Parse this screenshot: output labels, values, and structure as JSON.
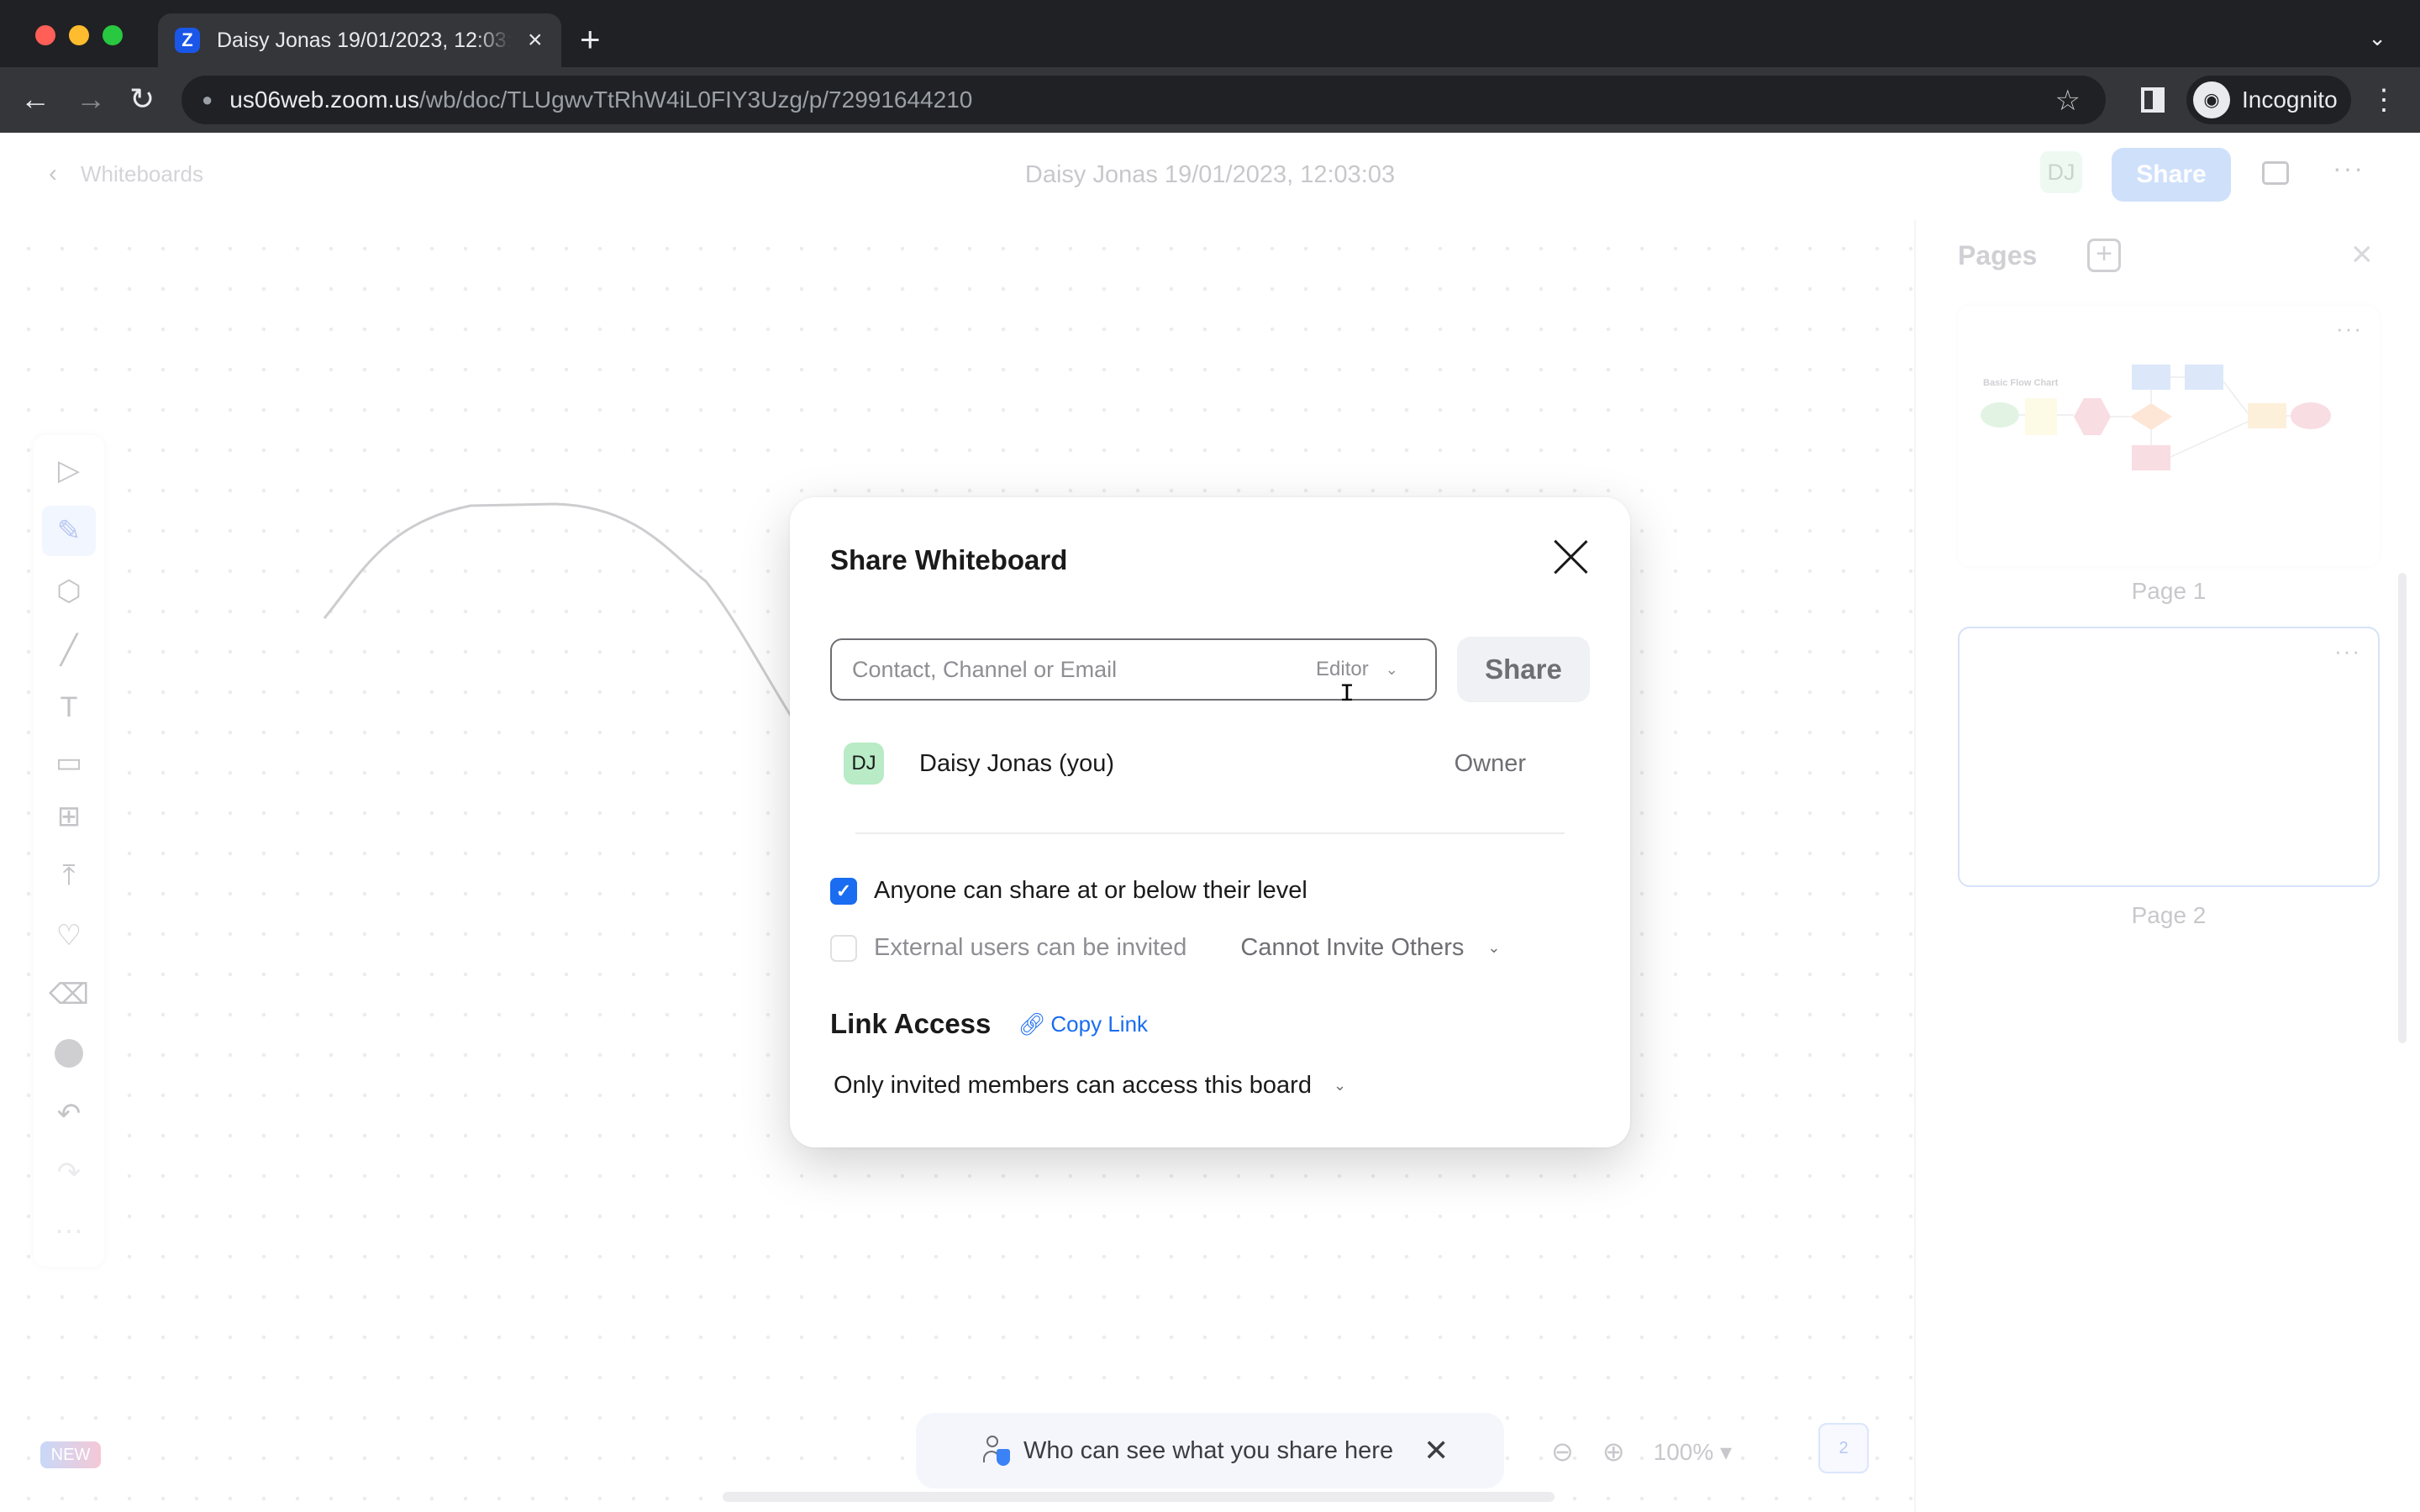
{
  "browser": {
    "tab_title": "Daisy Jonas 19/01/2023, 12:03:03",
    "tab_favicon": "Z",
    "tab_close": "×",
    "new_tab": "+",
    "tab_menu": "⌄",
    "url_host": "us06web.zoom.us",
    "url_path": "/wb/doc/TLUgwvTtRhW4iL0FIY3Uzg/p/72991644210",
    "incognito_label": "Incognito",
    "back_icon": "←",
    "forward_icon": "→",
    "reload_icon": "↻",
    "lock_icon": "🔒",
    "star_icon": "☆",
    "kebab_icon": "⋮"
  },
  "header": {
    "back_label": "Whiteboards",
    "back_icon": "‹",
    "doc_title": "Daisy Jonas 19/01/2023, 12:03:03",
    "avatar_initials": "DJ",
    "share_label": "Share",
    "more_icon": "···"
  },
  "toolbar": {
    "tools": [
      {
        "name": "select",
        "glyph": "▷",
        "active": false
      },
      {
        "name": "pen",
        "glyph": "✎",
        "active": true
      },
      {
        "name": "shape",
        "glyph": "⬡",
        "active": false
      },
      {
        "name": "line",
        "glyph": "╱",
        "active": false
      },
      {
        "name": "text",
        "glyph": "T",
        "active": false
      },
      {
        "name": "sticky-note",
        "glyph": "▭",
        "active": false
      },
      {
        "name": "template",
        "glyph": "⊞",
        "active": false
      },
      {
        "name": "upload",
        "glyph": "⤒",
        "active": false
      },
      {
        "name": "stamps",
        "glyph": "♡",
        "active": false
      },
      {
        "name": "eraser",
        "glyph": "⌫",
        "active": false
      },
      {
        "name": "color",
        "glyph": "",
        "active": false
      },
      {
        "name": "undo",
        "glyph": "↶",
        "active": false
      },
      {
        "name": "redo",
        "glyph": "↷",
        "active": false
      },
      {
        "name": "more",
        "glyph": "⋯",
        "active": false
      }
    ]
  },
  "canvas": {
    "new_badge": "NEW",
    "notice_text": "Who can see what you share here",
    "notice_close": "✕",
    "zoom_out_icon": "⊖",
    "zoom_in_icon": "⊕",
    "zoom_level": "100%",
    "zoom_caret": "▾",
    "page_count": "2"
  },
  "pages_panel": {
    "title": "Pages",
    "add_icon": "+",
    "close_icon": "×",
    "more_icon": "···",
    "thumb1_caption": "Basic Flow Chart",
    "pages": [
      {
        "label": "Page 1"
      },
      {
        "label": "Page 2"
      }
    ]
  },
  "modal": {
    "title": "Share Whiteboard",
    "invite_placeholder": "Contact, Channel or Email",
    "invite_value": "",
    "role_selected": "Editor",
    "share_label": "Share",
    "members": [
      {
        "initials": "DJ",
        "name": "Daisy Jonas (you)",
        "role": "Owner"
      }
    ],
    "option_share_level": {
      "label": "Anyone can share at or below their level",
      "checked": true
    },
    "option_external": {
      "label": "External users can be invited",
      "checked": false
    },
    "external_permission_selected": "Cannot Invite Others",
    "link_access_title": "Link Access",
    "copy_link_label": "Copy Link",
    "link_access_selected": "Only invited members can access this board",
    "chevron": "⌄",
    "check_glyph": "✓"
  },
  "colors": {
    "accent": "#1a6cf0",
    "share_button_disabled": "#cfe0fb",
    "avatar_bg": "#b8ebc6"
  }
}
